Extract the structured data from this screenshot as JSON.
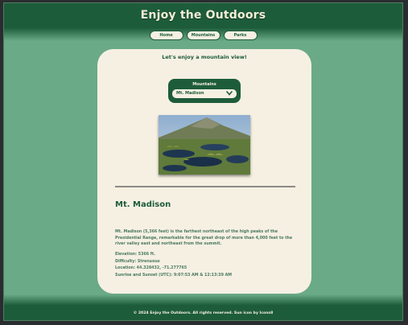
{
  "header": {
    "title": "Enjoy the Outdoors"
  },
  "nav": {
    "items": [
      {
        "label": "Home"
      },
      {
        "label": "Mountains"
      },
      {
        "label": "Parks"
      }
    ]
  },
  "main": {
    "subtitle": "Let's enjoy a mountain view!",
    "select": {
      "label": "Mountains",
      "value": "Mt. Madison"
    },
    "image": {
      "alt": "Mt. Madison"
    },
    "mountain": {
      "name": "Mt. Madison",
      "description": "Mt. Madison (5,366 feet) is the farthest northeast of the high peaks of the Presidential Range, remarkable for the great drop of more than 4,000 feet to the river valley east and northeast from the summit.",
      "elevation": "Elevation: 5366 ft.",
      "difficulty": "Difficulty: Strenuous",
      "location": "Location: 44.328432, -71.277765",
      "sun": "Sunrise and Sunset (UTC): 9:07:53 AM & 12:13:39 AM"
    }
  },
  "footer": {
    "text": "© 2024 Enjoy the Outdoors. All rights reserved. Sun icon by Icons8"
  },
  "colors": {
    "brand_green": "#1d5c3a",
    "page_green": "#6aaa86",
    "cream": "#f6f0e2"
  }
}
